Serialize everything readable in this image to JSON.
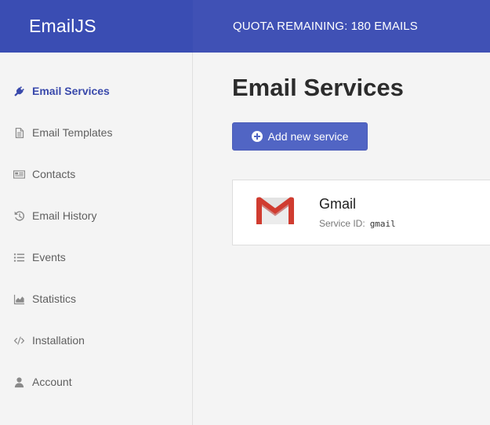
{
  "header": {
    "brand": "EmailJS",
    "quota": "QUOTA REMAINING: 180 EMAILS"
  },
  "sidebar": {
    "items": [
      {
        "label": "Email Services",
        "icon": "plug-icon",
        "active": true
      },
      {
        "label": "Email Templates",
        "icon": "document-icon",
        "active": false
      },
      {
        "label": "Contacts",
        "icon": "address-card-icon",
        "active": false
      },
      {
        "label": "Email History",
        "icon": "history-icon",
        "active": false
      },
      {
        "label": "Events",
        "icon": "list-icon",
        "active": false
      },
      {
        "label": "Statistics",
        "icon": "area-chart-icon",
        "active": false
      },
      {
        "label": "Installation",
        "icon": "code-icon",
        "active": false
      },
      {
        "label": "Account",
        "icon": "user-icon",
        "active": false
      }
    ]
  },
  "main": {
    "title": "Email Services",
    "add_button": "Add new service",
    "services": [
      {
        "name": "Gmail",
        "id_label": "Service ID:",
        "id_value": "gmail",
        "logo": "gmail-logo"
      }
    ]
  },
  "colors": {
    "brand": "#3a4db3",
    "header": "#4051b5",
    "accent": "#3949ab",
    "button": "#5165c4"
  }
}
